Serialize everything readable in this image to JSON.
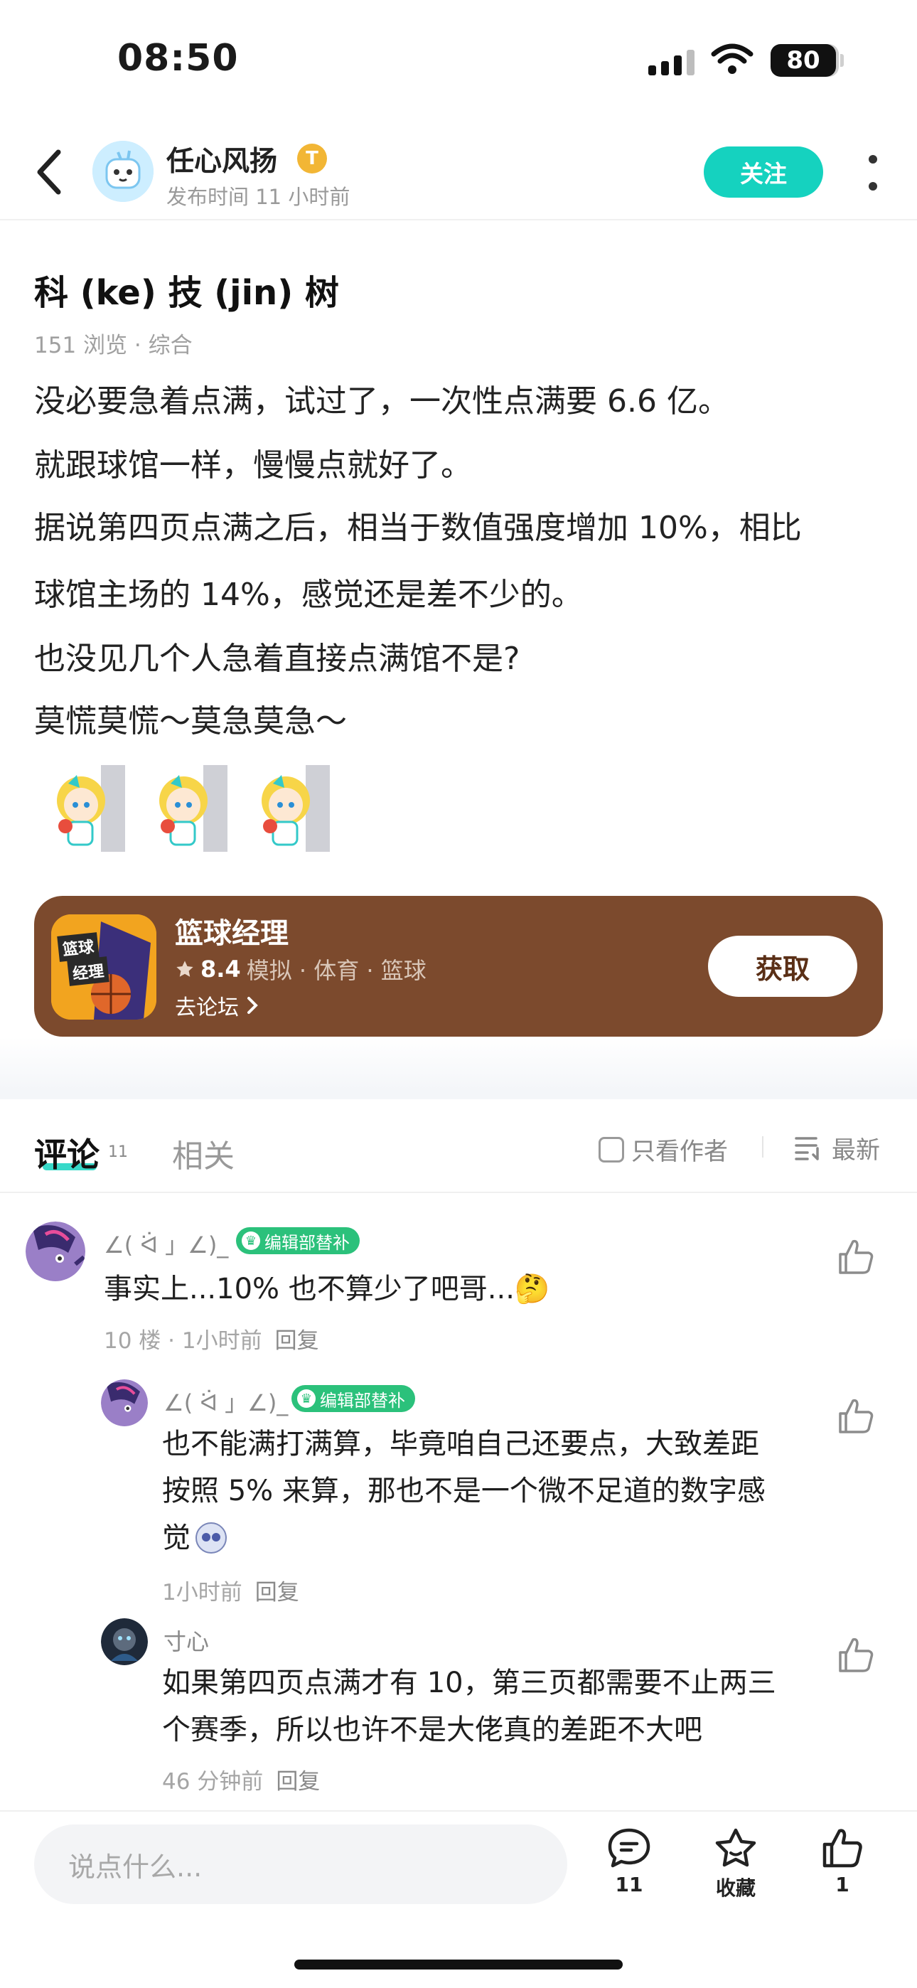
{
  "status_bar": {
    "time": "08:50",
    "battery": "80"
  },
  "header": {
    "author_name": "任心风扬",
    "author_badge": "T",
    "post_time": "发布时间 11 小时前",
    "follow_label": "关注"
  },
  "post": {
    "title": "科 (ke) 技 (jin) 树",
    "meta": "151 浏览 · 综合",
    "lines": [
      "没必要急着点满，试过了，一次性点满要 6.6 亿。",
      "就跟球馆一样，慢慢点就好了。",
      "据说第四页点满之后，相当于数值强度增加 10%，相比",
      "球馆主场的 14%，感觉还是差不少的。",
      "也没见几个人急着直接点满馆不是?",
      "莫慌莫慌～莫急莫急～"
    ]
  },
  "game_card": {
    "name": "篮球经理",
    "icon_text_1": "篮球",
    "icon_text_2": "经理",
    "rating": "8.4",
    "tags": "模拟 · 体育 · 篮球",
    "forum_link": "去论坛",
    "get_label": "获取"
  },
  "comments_section": {
    "tab_comments": "评论",
    "tab_count": "11",
    "tab_related": "相关",
    "author_only": "只看作者",
    "sort": "最新",
    "comments": [
      {
        "name": "∠( ᐛ 」∠)_",
        "badge": "编辑部替补",
        "text": "事实上...10% 也不算少了吧哥...🤔",
        "meta": "10 楼 · 1小时前",
        "reply": "回复",
        "replies": [
          {
            "name": "∠( ᐛ 」∠)_",
            "badge": "编辑部替补",
            "text_lines": [
              "也不能满打满算，毕竟咱自己还要点，大致差距",
              "按照 5% 来算，那也不是一个微不足道的数字感",
              "觉"
            ],
            "meta": "1小时前",
            "reply": "回复"
          },
          {
            "name": "寸心",
            "text_lines": [
              "如果第四页点满才有 10，第三页都需要不止两三",
              "个赛季，所以也许不是大佬真的差距不大吧"
            ],
            "meta": "46 分钟前",
            "reply": "回复"
          }
        ]
      }
    ]
  },
  "bottom_bar": {
    "input_placeholder": "说点什么...",
    "comment_count": "11",
    "favorite_label": "收藏",
    "like_count": "1"
  },
  "colors": {
    "accent": "#15d2bf",
    "game_card": "#7c4a2d",
    "badge_green": "#2bc17b",
    "author_badge": "#f2b635"
  }
}
